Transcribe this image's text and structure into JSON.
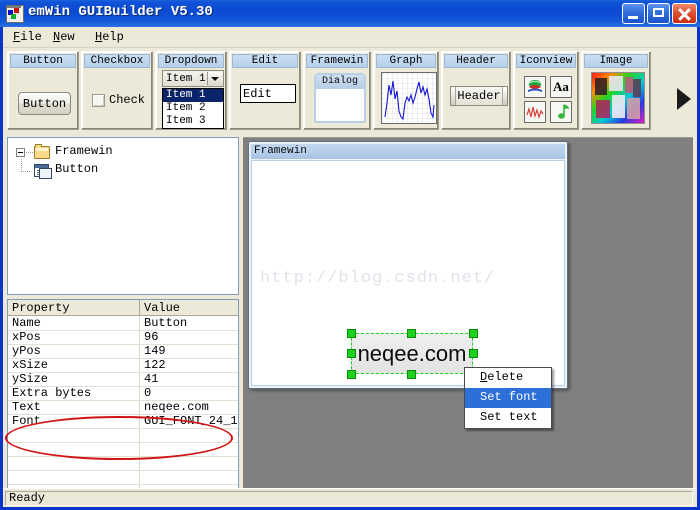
{
  "window": {
    "title": "emWin GUIBuilder V5.30",
    "icon": "app-icon",
    "minimize_label": "",
    "maximize_label": "",
    "close_label": ""
  },
  "menubar": {
    "items": [
      {
        "label": "File",
        "accel": "F"
      },
      {
        "label": "New",
        "accel": "N"
      },
      {
        "label": "Help",
        "accel": "H"
      }
    ]
  },
  "toolbox": {
    "groups": [
      {
        "title": "Button",
        "button_label": "Button"
      },
      {
        "title": "Checkbox",
        "check_label": "Check"
      },
      {
        "title": "Dropdown",
        "combo_value": "Item 1",
        "options": [
          "Item 1",
          "Item 2",
          "Item 3"
        ],
        "selected_index": 0
      },
      {
        "title": "Edit",
        "edit_value": "Edit"
      },
      {
        "title": "Framewin",
        "dialog_caption": "Dialog"
      },
      {
        "title": "Graph",
        "graph_icon": "waveform-graph"
      },
      {
        "title": "Header",
        "header_label": "Header"
      },
      {
        "title": "Iconview",
        "icons": [
          "books-globe-icon",
          "text-aa-icon",
          "waveform-icon",
          "music-note-icon"
        ]
      },
      {
        "title": "Image",
        "image_icon": "photo-collage-thumbnail"
      }
    ],
    "scroll_more": "scroll-right-arrow"
  },
  "tree": {
    "root": {
      "label": "Framewin",
      "icon": "folder-icon",
      "expanded": true
    },
    "children": [
      {
        "label": "Button",
        "icon": "widget-icon"
      }
    ]
  },
  "properties": {
    "columns": [
      "Property",
      "Value"
    ],
    "rows": [
      {
        "key": "Name",
        "value": "Button"
      },
      {
        "key": "xPos",
        "value": "96"
      },
      {
        "key": "yPos",
        "value": "149"
      },
      {
        "key": "xSize",
        "value": "122"
      },
      {
        "key": "ySize",
        "value": "41"
      },
      {
        "key": "Extra bytes",
        "value": "0"
      },
      {
        "key": "Text",
        "value": "neqee.com"
      },
      {
        "key": "Font",
        "value": "GUI_FONT_24_1"
      },
      {
        "key": "",
        "value": ""
      },
      {
        "key": "",
        "value": ""
      },
      {
        "key": "",
        "value": ""
      },
      {
        "key": "",
        "value": ""
      },
      {
        "key": "",
        "value": ""
      }
    ],
    "annotation": {
      "shape": "red-ellipse",
      "color": "#d01515"
    }
  },
  "canvas": {
    "design_window": {
      "caption": "Framewin",
      "watermark": "http://blog.csdn.net/"
    },
    "selected_widget": {
      "text": "neqee.com",
      "handle_color": "#1ed11e",
      "outline_color": "#18d018"
    },
    "context_menu": {
      "items": [
        {
          "label": "Delete",
          "accel": "D",
          "selected": false
        },
        {
          "label": "Set font",
          "accel": "",
          "selected": true
        },
        {
          "label": "Set text",
          "accel": "",
          "selected": false
        }
      ]
    }
  },
  "statusbar": {
    "text": "Ready"
  },
  "colors": {
    "titlebar": "#0b49d2",
    "face": "#ece9d8",
    "workspace": "#808080",
    "menu_highlight": "#2d6fd8",
    "list_highlight": "#0a246a",
    "annotation_red": "#d01515"
  }
}
